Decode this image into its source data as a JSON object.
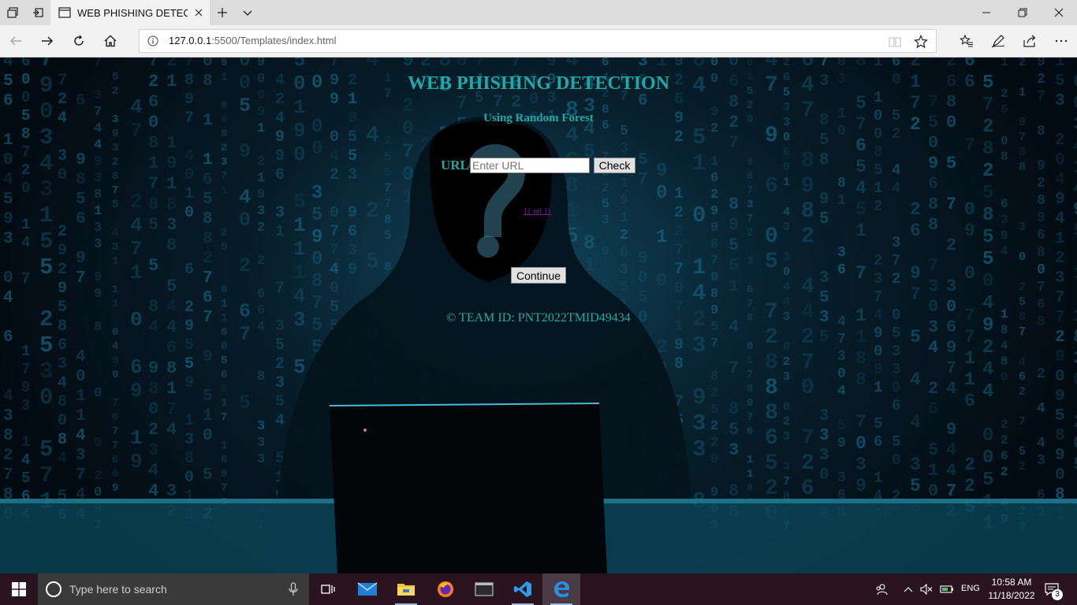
{
  "browser": {
    "tab_title": "WEB PHISHING DETECT",
    "url_host": "127.0.0.1",
    "url_path": ":5500/Templates/index.html"
  },
  "page": {
    "title": "WEB PHISHING DETECTION",
    "subtitle": "Using Random Forest",
    "url_label": "URL",
    "url_placeholder": "Enter URL",
    "check_label": "Check",
    "result_link": "{{ url }}",
    "continue_label": "Continue",
    "team_id": "© TEAM ID: PNT2022TMID49434"
  },
  "taskbar": {
    "search_placeholder": "Type here to search",
    "language": "ENG",
    "time": "10:58 AM",
    "date": "11/18/2022",
    "notification_count": "3"
  },
  "colors": {
    "accent_teal": "#1fa9a6",
    "link_purple": "#7a1fa3",
    "taskbar_bg": "#2a1420"
  }
}
